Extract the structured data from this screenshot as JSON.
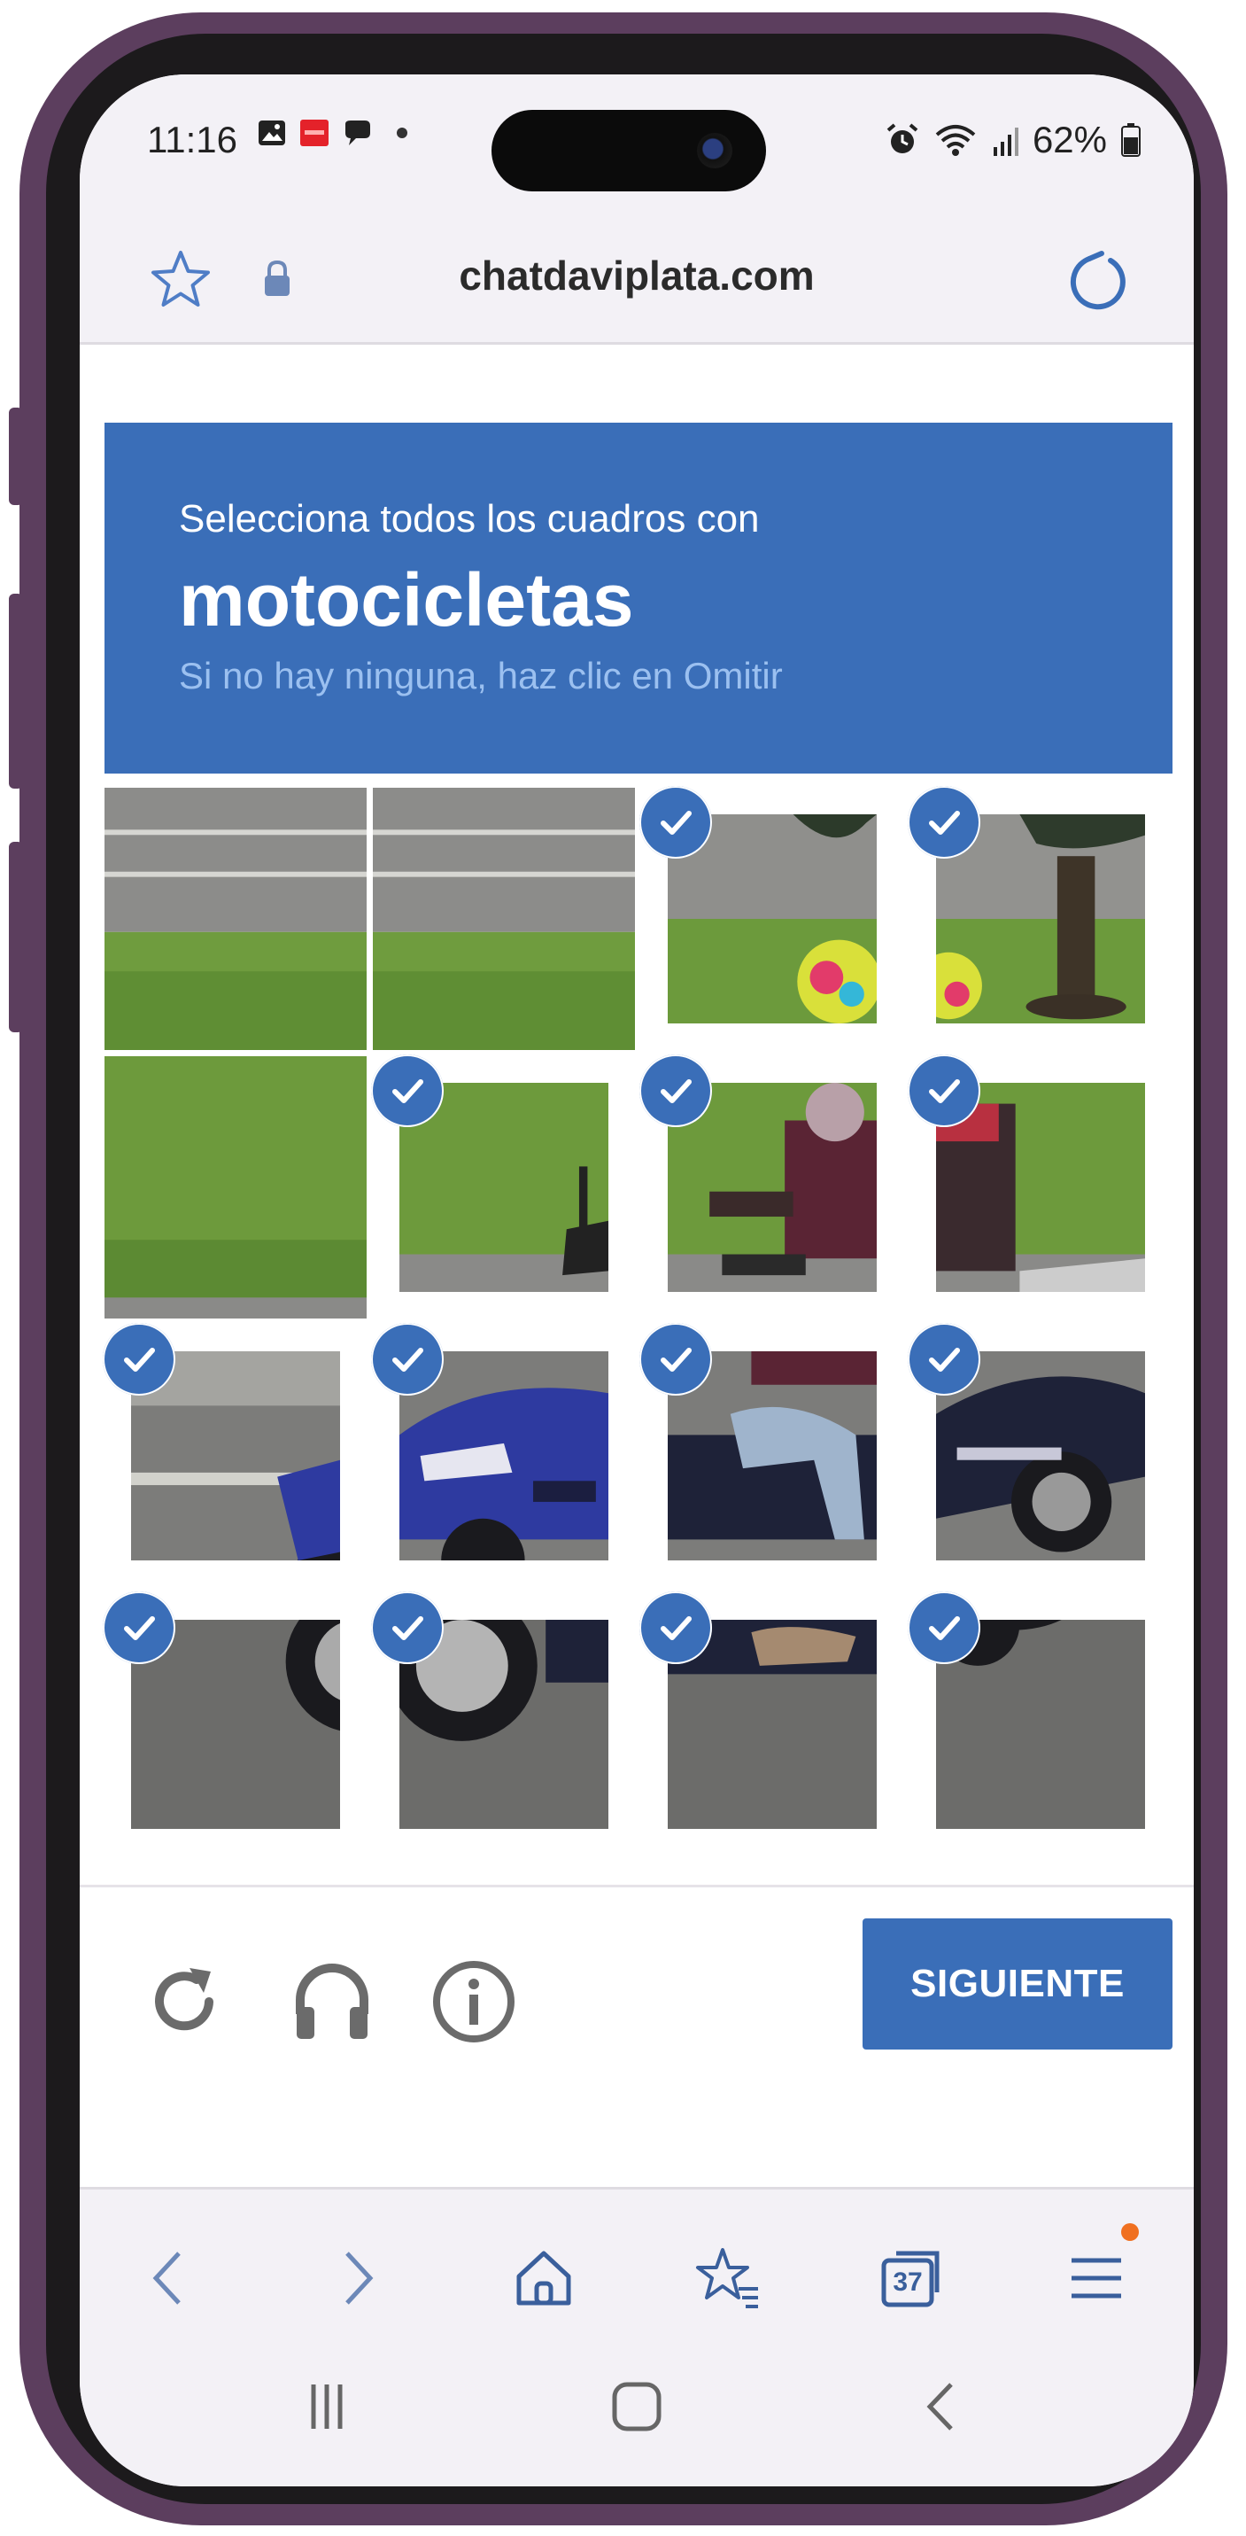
{
  "status_bar": {
    "time": "11:16",
    "battery": "62%",
    "notification_icons": [
      "image-icon",
      "red-app-icon",
      "chat-bubble-icon",
      "dot-icon"
    ],
    "right_icons": [
      "alarm-icon",
      "wifi-icon",
      "signal-icon",
      "battery-icon"
    ]
  },
  "browser": {
    "url": "chatdaviplata.com"
  },
  "captcha": {
    "instruction": "Selecciona todos los cuadros con",
    "keyword": "motocicletas",
    "hint": "Si no hay ninguna, haz clic en Omitir",
    "tiles": [
      {
        "selected": false,
        "scene": "road-grass"
      },
      {
        "selected": false,
        "scene": "road-grass"
      },
      {
        "selected": true,
        "scene": "grass-helmet"
      },
      {
        "selected": true,
        "scene": "palm-helmet"
      },
      {
        "selected": false,
        "scene": "grass"
      },
      {
        "selected": true,
        "scene": "grass-mirror"
      },
      {
        "selected": true,
        "scene": "rider-torso"
      },
      {
        "selected": true,
        "scene": "rider-back"
      },
      {
        "selected": true,
        "scene": "road-wheel"
      },
      {
        "selected": true,
        "scene": "moto-front"
      },
      {
        "selected": true,
        "scene": "rider-legs"
      },
      {
        "selected": true,
        "scene": "moto-rear"
      },
      {
        "selected": true,
        "scene": "road-tire"
      },
      {
        "selected": true,
        "scene": "front-wheel"
      },
      {
        "selected": true,
        "scene": "underbody"
      },
      {
        "selected": true,
        "scene": "rear-road"
      }
    ],
    "next_label": "SIGUIENTE",
    "controls": [
      "reload-icon",
      "headphones-icon",
      "info-icon"
    ]
  },
  "bottom_nav": {
    "tabs_count": "37",
    "items": [
      "back-icon",
      "forward-icon",
      "home-icon",
      "bookmarks-icon",
      "tabs-icon",
      "menu-icon"
    ]
  },
  "colors": {
    "accent": "#3a6eb8",
    "hint": "#9bc0f0",
    "frame": "#5c3e5e",
    "notification_dot": "#f07020"
  }
}
